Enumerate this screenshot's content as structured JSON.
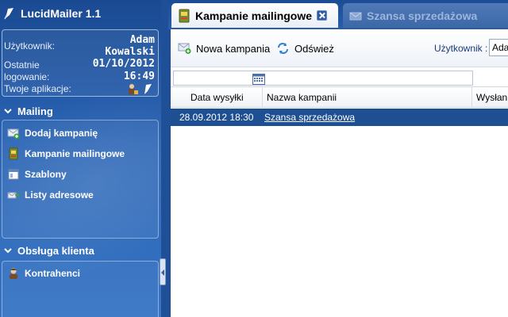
{
  "app": {
    "title": "LucidMailer 1.1"
  },
  "user_info": {
    "user_label": "Użytkownik:",
    "user_first": "Adam",
    "user_last": "Kowalski",
    "last_label": "Ostatnie",
    "last_date": "01/10/2012",
    "login_label": "logowanie:",
    "login_time": "16:49",
    "apps_label": "Twoje aplikacje:"
  },
  "sections": {
    "mailing": {
      "title": "Mailing",
      "items": [
        {
          "label": "Dodaj kampanię",
          "icon": "mail-add-icon"
        },
        {
          "label": "Kampanie mailingowe",
          "icon": "campaign-book-icon"
        },
        {
          "label": "Szablony",
          "icon": "template-icon"
        },
        {
          "label": "Listy adresowe",
          "icon": "address-list-icon"
        }
      ]
    },
    "customer": {
      "title": "Obsługa klienta",
      "items": [
        {
          "label": "Kontrahenci",
          "icon": "contractor-icon"
        }
      ]
    }
  },
  "tabs": [
    {
      "label": "Kampanie mailingowe",
      "active": true
    },
    {
      "label": "Szansa sprzedażowa",
      "active": false
    }
  ],
  "toolbar": {
    "new_campaign": "Nowa kampania",
    "refresh": "Odśwież",
    "user_filter_label": "Użytkownik :",
    "user_filter_value": "Ada"
  },
  "grid": {
    "columns": [
      "Data wysyłki",
      "Nazwa kampanii",
      "Wysłan"
    ],
    "rows": [
      {
        "date": "28.09.2012 18:30",
        "name": "Szansa sprzedażowa"
      }
    ]
  },
  "colors": {
    "sidebar_bg": "#2a64b4",
    "selected_row": "#1d4f92",
    "accent": "#1f4f96"
  }
}
